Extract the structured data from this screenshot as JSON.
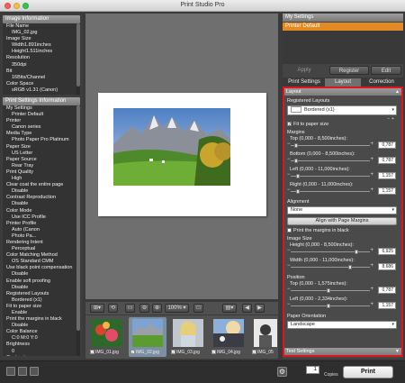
{
  "window": {
    "title": "Print Studio Pro"
  },
  "left_panel": {
    "image_info_header": "Image Information",
    "image_info": [
      "File Name",
      "  IMG_02.jpg",
      "Image Size",
      "  Width1.891inches",
      "  Height1.511inches",
      "Resolution",
      "  350dpi",
      "Bit",
      "  16Bits/Channel",
      "Color Space",
      "  sRGB v1.31 (Canon)"
    ],
    "print_settings_header": "Print Settings Information",
    "print_settings": [
      "My Settings",
      "  Printer Default",
      "Printer",
      "  Canon                    series",
      "Media Type",
      "  Photo Paper Pro Platinum",
      "Paper Size",
      "  US Letter",
      "Paper Source",
      "  Rear Tray",
      "Print Quality",
      "  High",
      "Clear coat the entire page",
      "  Disable",
      "Contrast Reproduction",
      "  Disable",
      "Color Mode",
      "  Use ICC Profile",
      "Printer Profile",
      "  Auto (Canon",
      "                      Photo Pa...",
      "Rendering Intent",
      "  Perceptual",
      "Color Matching Method",
      "  OS Standard CMM",
      "Use black point compensation",
      "  Disable",
      "Enable soft proofing",
      "  Disable",
      "Registered Layouts",
      "  Bordered (x1)",
      "Fit to paper size",
      "  Enable",
      "Print the margins in black",
      "  Disable",
      "Color Balance",
      "  C:0 M:0 Y:0",
      "Brightness",
      "  0",
      "Contrast"
    ]
  },
  "preview_toolbar": {
    "zoom": "100%"
  },
  "thumbnails": [
    {
      "label": "IMG_01.jpg",
      "checked": true
    },
    {
      "label": "IMG_02.jpg",
      "checked": true
    },
    {
      "label": "IMG_03.jpg",
      "checked": true
    },
    {
      "label": "IMG_04.jpg",
      "checked": true
    },
    {
      "label": "IMG_05",
      "checked": true
    }
  ],
  "right_panel": {
    "my_settings_header": "My Settings",
    "my_settings_selected": "Printer Default",
    "apply": "Apply",
    "register": "Register",
    "edit": "Edit",
    "tabs": [
      "Print Settings",
      "Layout",
      "Correction"
    ],
    "layout": {
      "header": "Layout",
      "registered_layouts_label": "Registered Layouts",
      "registered_layouts_value": "Bordered (x1)",
      "fit_to_paper": "Fit to paper size",
      "margins_label": "Margins",
      "top_label": "Top (0,000 - 8,500inches):",
      "top_value": "0,787",
      "bottom_label": "Bottom (0,000 - 8,500inches):",
      "bottom_value": "0,787",
      "left_label": "Left (0,000 - 11,000inches):",
      "left_value": "1,157",
      "right_label": "Right (0,000 - 11,000inches):",
      "right_value": "1,157",
      "alignment_label": "Alignment",
      "alignment_value": "None",
      "align_btn": "Align with Page Margins",
      "print_margins_black": "Print the margins in black",
      "image_size_label": "Image Size",
      "height_label": "Height (0,000 - 8,500inches):",
      "height_value": "6,925",
      "width_label": "Width (0,000 - 11,000inches):",
      "width_value": "8,686",
      "position_label": "Position",
      "pos_top_label": "Top (0,000 - 1,575inches):",
      "pos_top_value": "0,787",
      "pos_left_label": "Left (0,000 - 2,334inches):",
      "pos_left_value": "1,157",
      "orientation_label": "Paper Orientation",
      "orientation_value": "Landscape"
    },
    "text_settings_header": "Text Settings"
  },
  "bottom": {
    "copies_value": "1",
    "copies_label": "Copies",
    "print": "Print"
  },
  "colors": {
    "accent": "#e28a23",
    "highlight_border": "#e0141b"
  }
}
